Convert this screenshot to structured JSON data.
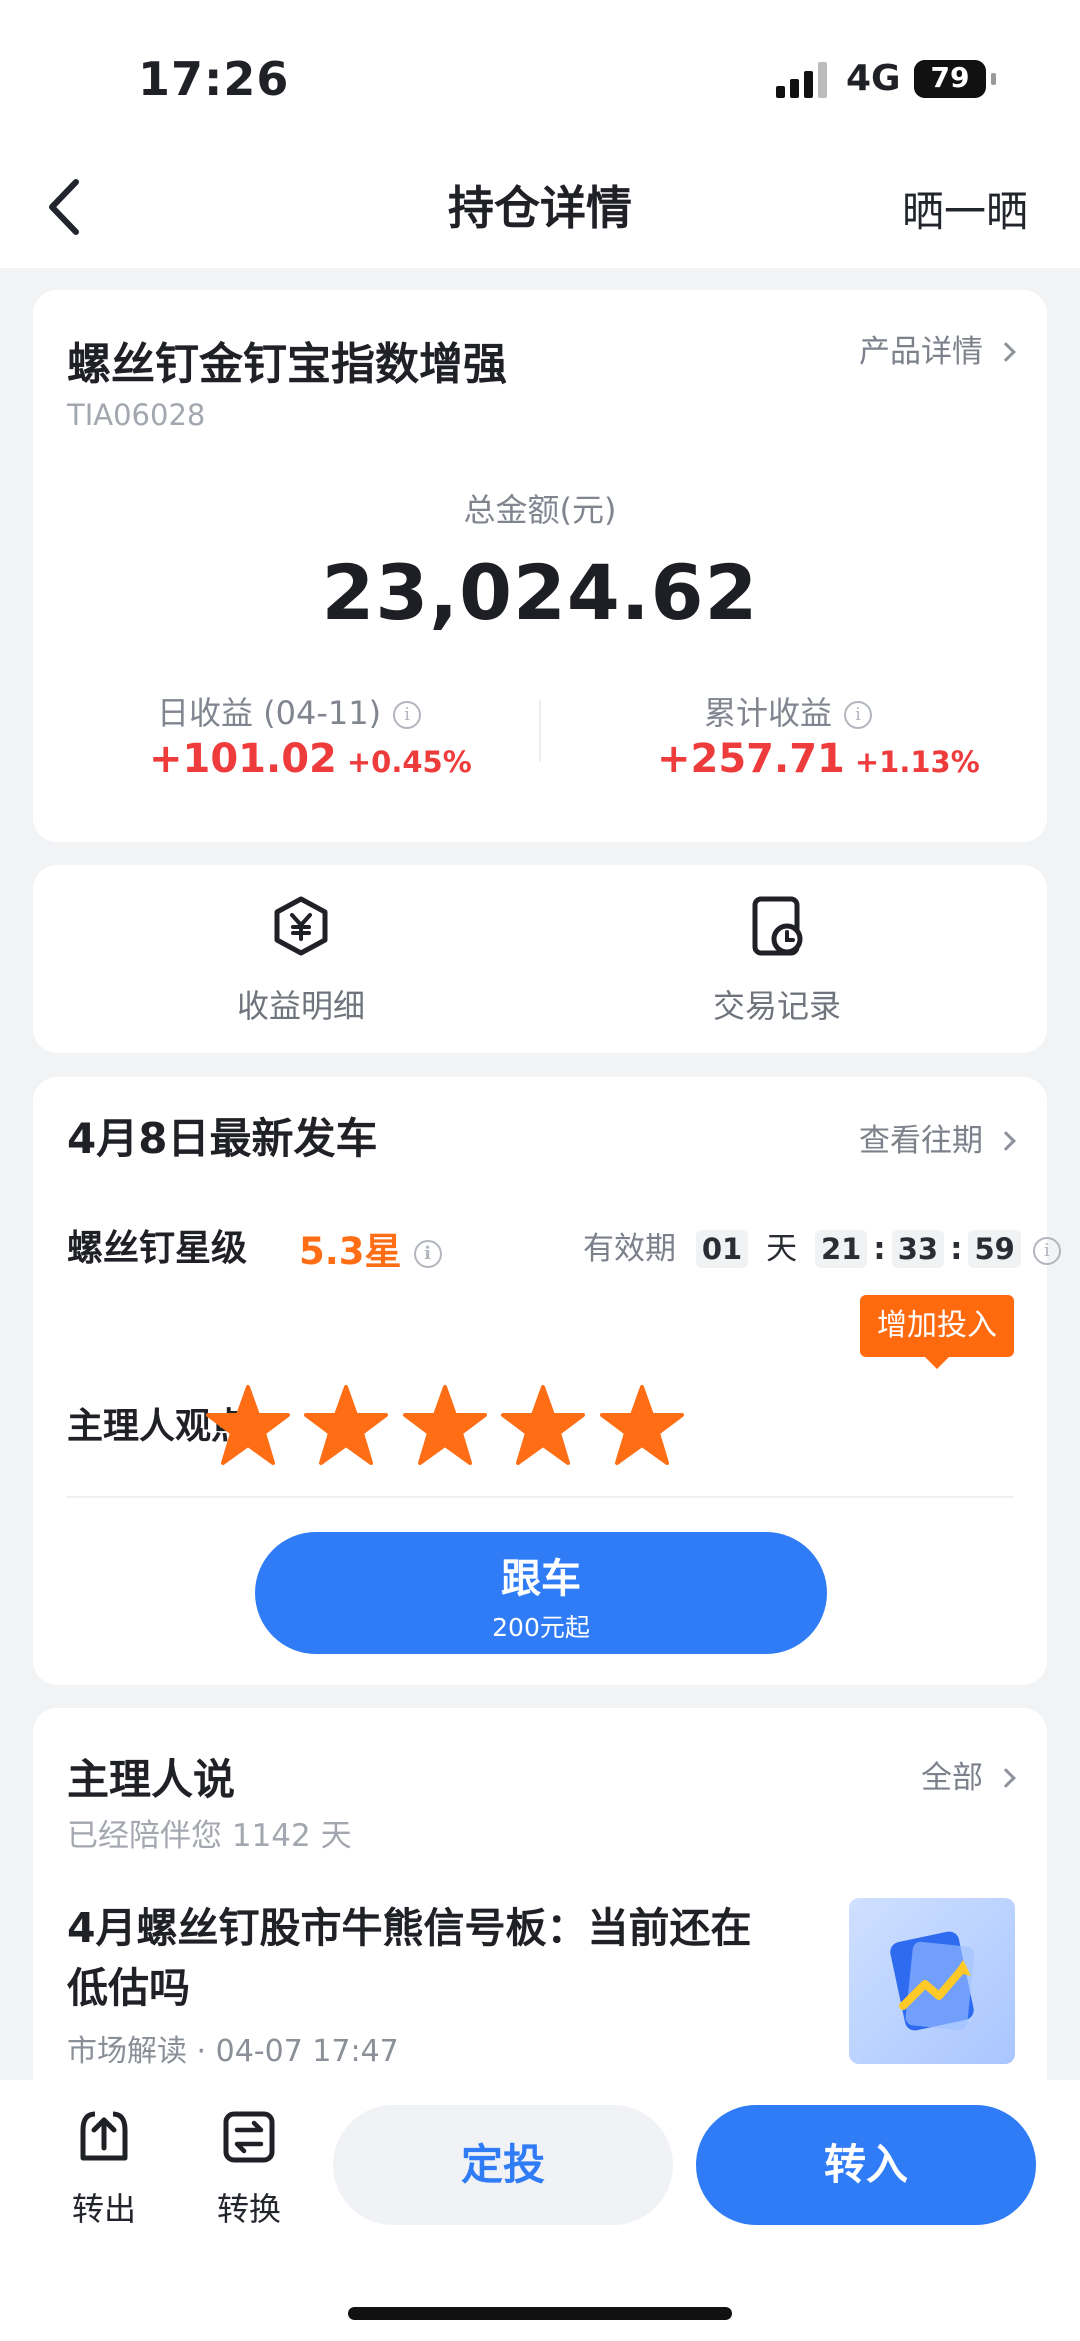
{
  "status_bar": {
    "time": "17:26",
    "network": "4G",
    "battery": "79",
    "battery_level": 0.79
  },
  "nav": {
    "title": "持仓详情",
    "share": "晒一晒"
  },
  "fund": {
    "name": "螺丝钉金钉宝指数增强",
    "code": "TIA06028",
    "detail_link": "产品详情",
    "total_label": "总金额(元)",
    "total_value": "23,024.62",
    "daily_label": "日收益 (04-11)",
    "daily_gain": "+101.02",
    "daily_pct": "+0.45%",
    "cum_label": "累计收益",
    "cum_gain": "+257.71",
    "cum_pct": "+1.13%"
  },
  "quick_actions": [
    {
      "label": "收益明细",
      "icon": "yuan-hexagon-icon"
    },
    {
      "label": "交易记录",
      "icon": "record-clock-icon"
    }
  ],
  "signal": {
    "title": "4月8日最新发车",
    "history_link": "查看往期",
    "rating_label": "螺丝钉星级",
    "rating_value": "5.3星",
    "valid_label": "有效期",
    "valid_days": "01",
    "day_unit": "天",
    "valid_h": "21",
    "valid_m": "33",
    "valid_s": "59",
    "view_label": "主理人观点",
    "view_stars": 5,
    "tag": "增加投入",
    "follow_main": "跟车",
    "follow_sub": "200元起"
  },
  "manager": {
    "title": "主理人说",
    "all_link": "全部",
    "companion": "已经陪伴您 1142 天",
    "article_title": "4月螺丝钉股市牛熊信号板：当前还在低估吗",
    "article_meta": "市场解读 · 04-07 17:47"
  },
  "bottom_bar": {
    "transfer_out": "转出",
    "switch": "转换",
    "auto_invest": "定投",
    "transfer_in": "转入"
  },
  "colors": {
    "accent": "#2f7cf6",
    "gain": "#ee3c3c",
    "star": "#ff6d14"
  }
}
